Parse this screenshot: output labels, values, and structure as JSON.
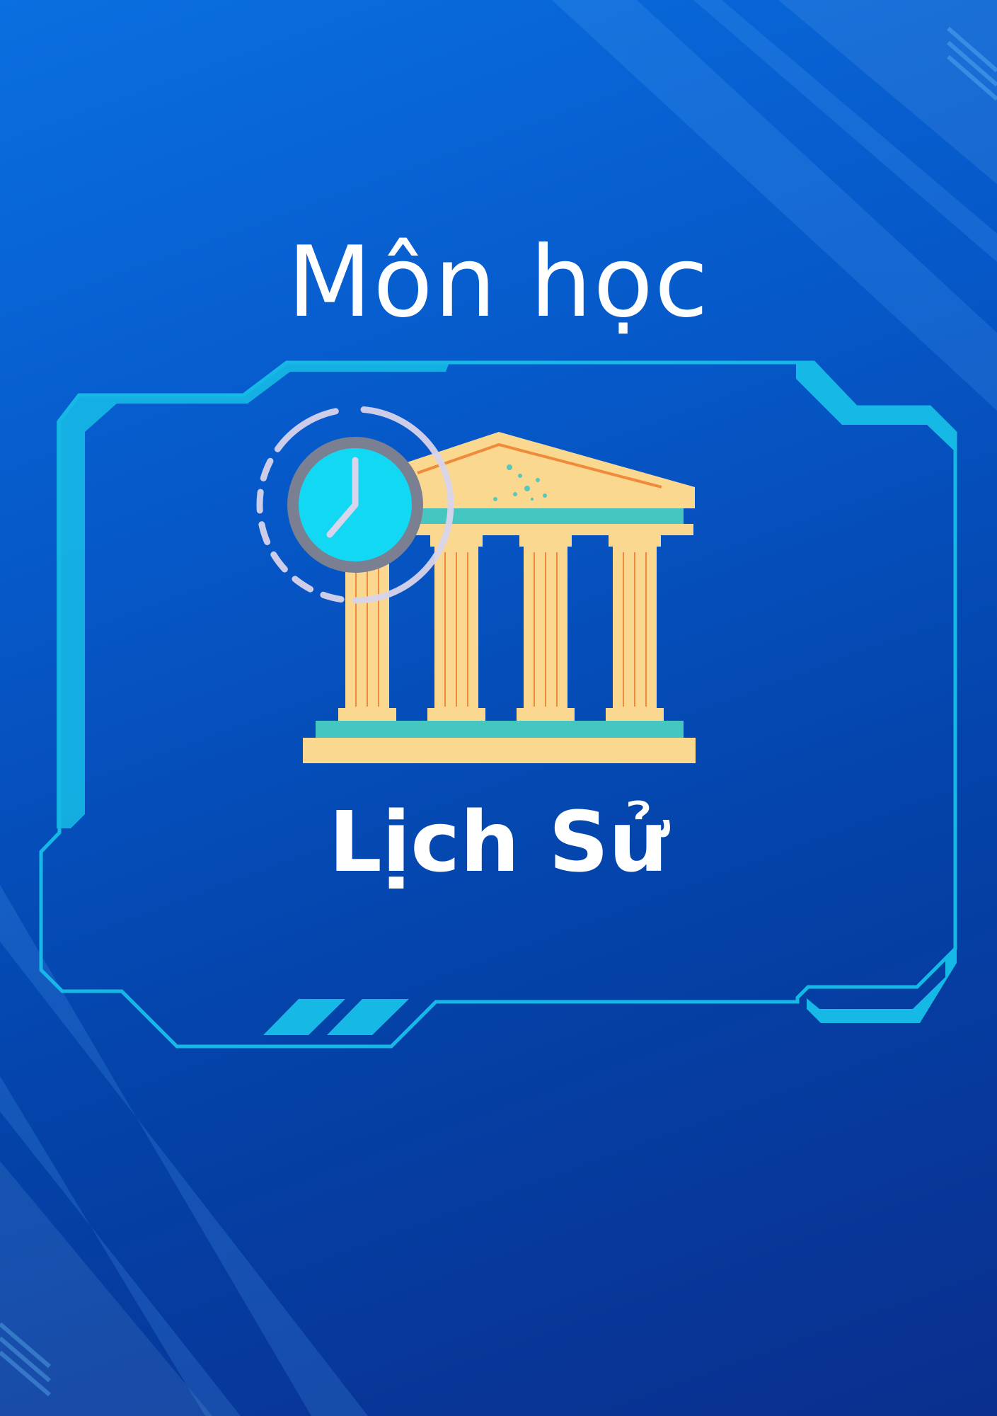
{
  "cover": {
    "subtitle": "Môn học",
    "title": "Lịch Sử"
  },
  "icons": {
    "illustration": "temple-icon",
    "clock": "clock-icon"
  },
  "colors": {
    "background_top": "#0a6fe0",
    "background_bottom": "#0a2f8e",
    "frame": "#16b8e6",
    "column": "#fbd890",
    "column_line": "#f08a3c",
    "column_band": "#45c6c0",
    "clock_face": "#13d8f4",
    "clock_ring": "#7a7f92",
    "clock_dash": "#d8d4ec",
    "text": "#ffffff"
  }
}
